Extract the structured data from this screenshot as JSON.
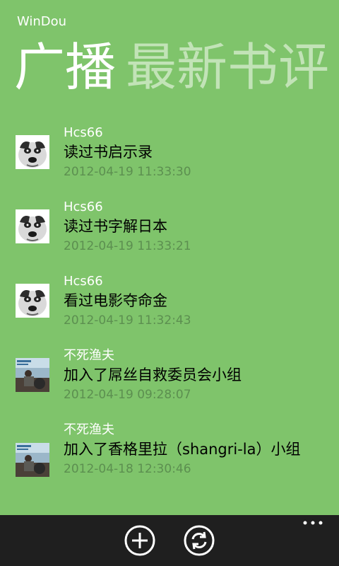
{
  "app": {
    "title": "WinDou"
  },
  "pivot": {
    "tabs": [
      {
        "label": "广播"
      },
      {
        "label": "最新书评"
      }
    ]
  },
  "feed": {
    "items": [
      {
        "user": "Hcs66",
        "action": "读过书启示录",
        "time": "2012-04-19 11:33:30",
        "avatar": "husky-avatar"
      },
      {
        "user": "Hcs66",
        "action": "读过书字解日本",
        "time": "2012-04-19 11:33:21",
        "avatar": "husky-avatar"
      },
      {
        "user": "Hcs66",
        "action": "看过电影夺命金",
        "time": "2012-04-19 11:32:43",
        "avatar": "husky-avatar"
      },
      {
        "user": "不死渔夫",
        "action": "加入了屌丝自救委员会小组",
        "time": "2012-04-19 09:28:07",
        "avatar": "photo-avatar"
      },
      {
        "user": "不死渔夫",
        "action": "加入了香格里拉（shangri-la）小组",
        "time": "2012-04-18 12:30:46",
        "avatar": "photo-avatar"
      }
    ]
  },
  "appbar": {
    "buttons": [
      {
        "icon": "add-icon"
      },
      {
        "icon": "refresh-icon"
      }
    ],
    "more_icon": "ellipsis-icon"
  },
  "colors": {
    "accent_bg": "#7fc46b",
    "appbar_bg": "#1f1f1f",
    "inactive_pivot": "#c2e3b7",
    "timestamp": "#5c8f50"
  }
}
